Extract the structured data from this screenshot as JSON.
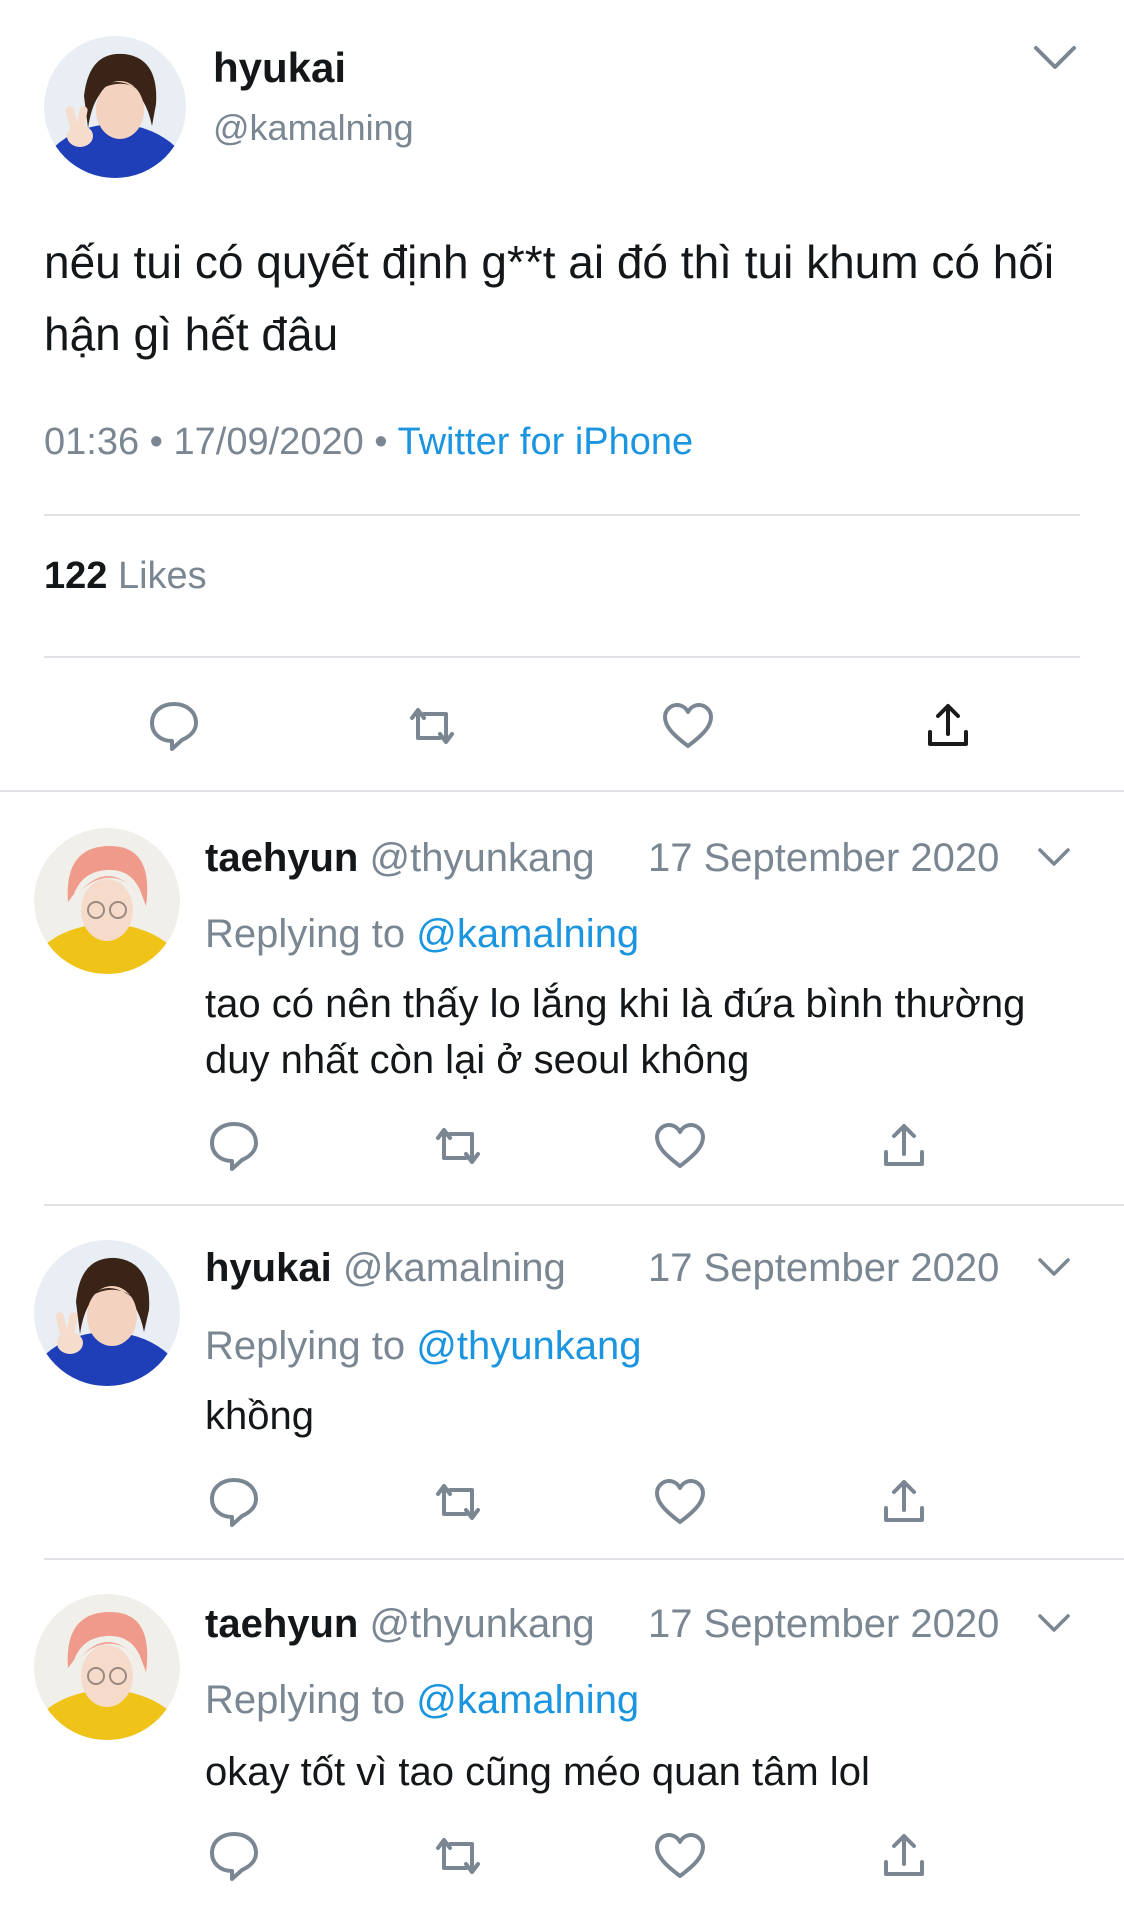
{
  "main_tweet": {
    "name": "hyukai",
    "handle": "@kamalning",
    "text": "nếu tui có quyết định g**t ai đó thì tui khum có hối hận gì hết đâu",
    "time": "01:36",
    "date": "17/09/2020",
    "separator": "•",
    "source": "Twitter for iPhone",
    "likes_count": "122",
    "likes_label": "Likes",
    "avatar_icon": "avatar-boy-peace-sign"
  },
  "replies": [
    {
      "name": "taehyun",
      "handle": "@thyunkang",
      "date": "17 September 2020",
      "replying_label": "Replying to",
      "replying_to": "@kamalning",
      "text": "tao có nên thấy lo lắng khi là đứa bình thường duy nhất còn lại ở seoul không",
      "avatar_icon": "avatar-pink-hair"
    },
    {
      "name": "hyukai",
      "handle": "@kamalning",
      "date": "17 September 2020",
      "replying_label": "Replying to",
      "replying_to": "@thyunkang",
      "text": "khồng",
      "avatar_icon": "avatar-boy-peace-sign"
    },
    {
      "name": "taehyun",
      "handle": "@thyunkang",
      "date": "17 September 2020",
      "replying_label": "Replying to",
      "replying_to": "@kamalning",
      "text": "okay tốt vì tao cũng méo quan tâm lol",
      "avatar_icon": "avatar-pink-hair"
    }
  ],
  "icons": {
    "reply": "reply-icon",
    "retweet": "retweet-icon",
    "like": "like-icon",
    "share": "share-icon",
    "menu": "chevron-down-icon"
  },
  "colors": {
    "text": "#14171a",
    "secondary": "#7a8793",
    "link": "#1b95e0",
    "divider": "#dfe3e7"
  }
}
